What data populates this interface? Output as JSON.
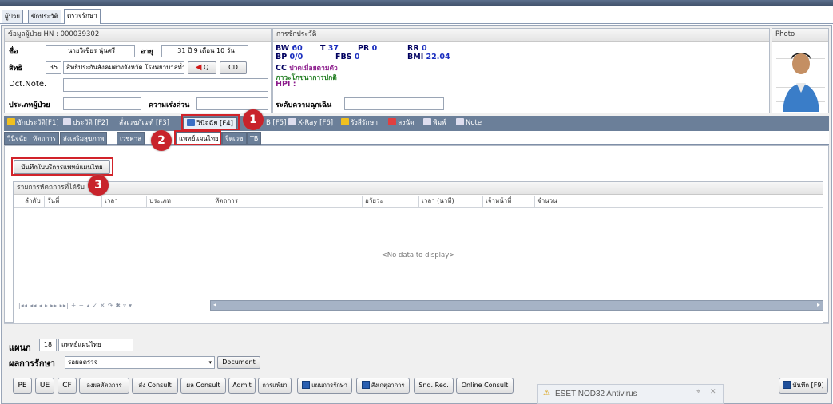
{
  "outer_tabs": [
    "ผู้ป่วย",
    "ซักประวัติ",
    "ตรวจรักษา"
  ],
  "patient_panel": {
    "header": "ข้อมูลผู้ป่วย HN : 000039302",
    "name_label": "ชื่อ",
    "name_value": "นายวิเชียร นุ่นศรี",
    "age_label": "อายุ",
    "age_value": "31 ปี 9 เดือน 10 วัน",
    "right_label": "สิทธิ",
    "right_code": "35",
    "right_value": "สิทธิประกันสังคมต่างจังหวัด โรงพยาบาลทั่วไป โรง",
    "q_button": "Q",
    "cd_button": "CD",
    "dct_label": "Dct.Note.",
    "dct_value": "",
    "type_label": "ประเภทผู้ป่วย",
    "type_value": "",
    "urgency_label": "ความเร่งด่วน",
    "urgency_value": ""
  },
  "history_panel": {
    "header": "การซักประวัติ",
    "bw_label": "BW",
    "bw_value": "60",
    "t_label": "T",
    "t_value": "37",
    "pr_label": "PR",
    "pr_value": "0",
    "rr_label": "RR",
    "rr_value": "0",
    "bp_label": "BP",
    "bp_value": "0/0",
    "fbs_label": "FBS",
    "fbs_value": "0",
    "bmi_label": "BMI",
    "bmi_value": "22.04",
    "cc_label": "CC",
    "cc_value": "ปวดเมื่อยตามตัว",
    "nutrition": "ภาวะโภชนาการปกติ",
    "hpi_label": "HPI :",
    "emergency_label": "ระดับความฉุกเฉิน",
    "emergency_value": ""
  },
  "photo_panel": {
    "header": "Photo"
  },
  "main_tabs": [
    "ซักประวัติ[F1]",
    "ประวัติ [F2]",
    "สั่งเวชภัณฑ์ [F3]",
    "วินิจฉัย [F4]",
    "B [F5]",
    "X-Ray [F6]",
    "รังสีรักษา",
    "ลงนัด",
    "พิมพ์",
    "Note"
  ],
  "sub_tabs": [
    "วินิจฉัย",
    "หัตถการ",
    "ส่งเสริมสุขภาพ",
    "เวชศาส",
    "แพทย์แผนไทย",
    "จิตเวช",
    "TB"
  ],
  "save_thai_button": "บันทึกใบบริการแพทย์แผนไทย",
  "grid": {
    "title": "รายการหัตถการที่ได้รับ",
    "columns": [
      "ลำดับ",
      "วันที่",
      "เวลา",
      "ประเภท",
      "หัตถการ",
      "อวัยวะ",
      "เวลา (นาที)",
      "เจ้าหน้าที่",
      "จำนวน"
    ],
    "empty_text": "<No data to display>",
    "navigator": "|◂◂ ◂◂ ◂ ▸ ▸▸ ▸▸| + − ▴ ✓ ✕ ↷ ✱ ▿ ▾"
  },
  "annotations": [
    "1",
    "2",
    "3"
  ],
  "department": {
    "label": "แผนก",
    "code": "18",
    "value": "แพทย์แผนไทย"
  },
  "result": {
    "label": "ผลการรักษา",
    "value": "รอผลตรวจ",
    "document_button": "Document"
  },
  "bottom_buttons": [
    "PE",
    "UE",
    "CF",
    "ลงผลหัตถการ",
    "ส่ง Consult",
    "ผล Consult",
    "Admit",
    "การแพ้ยา",
    "แผนการรักษา",
    "สังเกตุอาการ",
    "Snd. Rec.",
    "Online Consult"
  ],
  "antivirus_toast": "ESET NOD32 Antivirus",
  "save_button": "บันทึก [F9]"
}
